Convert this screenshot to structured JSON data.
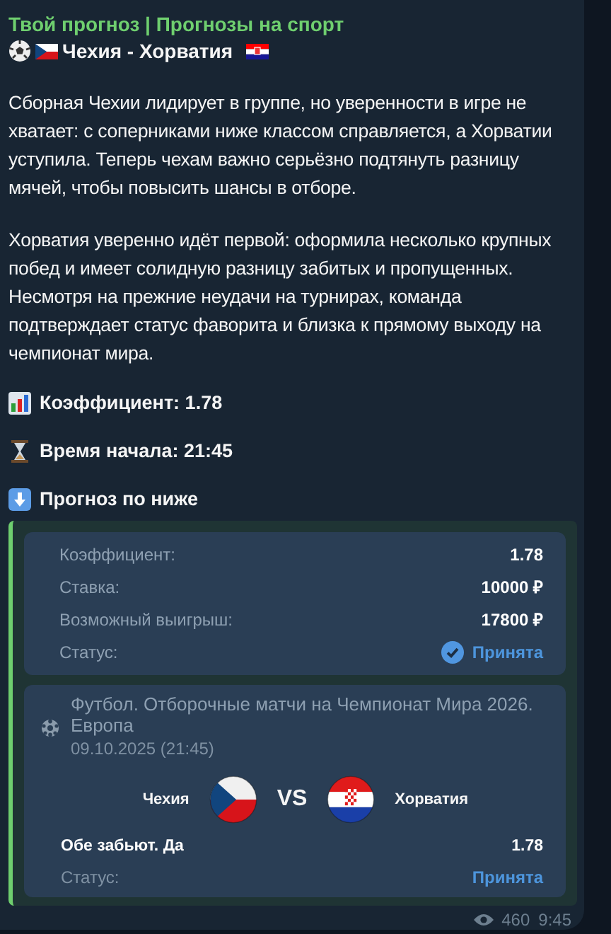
{
  "channel_title": "Твой прогноз | Прогнозы на спорт",
  "headline": {
    "text": "Чехия - Хорватия"
  },
  "paragraphs": [
    "Сборная Чехии лидирует в группе, но уверенности в игре не хватает: с соперниками ниже классом справляется, а Хорватии уступила. Теперь чехам важно серьёзно подтянуть разницу мячей, чтобы повысить шансы в отборе.",
    "Хорватия уверенно идёт первой: оформила несколько крупных побед и имеет солидную разницу забитых и пропущенных. Несмотря на прежние неудачи на турнирах, команда подтверждает статус фаворита и близка к прямому выходу на чемпионат мира."
  ],
  "info_lines": [
    {
      "kind": "chart",
      "text": "Коэффициент: 1.78"
    },
    {
      "kind": "hourglass",
      "text": "Время начала: 21:45"
    },
    {
      "kind": "arrow",
      "text": "Прогноз по ниже"
    }
  ],
  "slip_rows": [
    {
      "kind": "plain",
      "label": "Коэффициент:",
      "value": "1.78"
    },
    {
      "kind": "plain",
      "label": "Ставка:",
      "value": "10000 ₽"
    },
    {
      "kind": "plain",
      "label": "Возможный выигрыш:",
      "value": "17800 ₽"
    },
    {
      "kind": "status",
      "label": "Статус:",
      "value": "Принята"
    }
  ],
  "event": {
    "tournament": "Футбол. Отборочные матчи на Чемпионат Мира 2026. Европа",
    "date": "09.10.2025 (21:45)",
    "home": {
      "name": "Чехия"
    },
    "vs": "VS",
    "away": {
      "name": "Хорватия"
    },
    "pick": "Обе забьют. Да",
    "odds": "1.78",
    "status_label": "Статус:",
    "status_value": "Принята"
  },
  "footer": {
    "views": "460",
    "time": "9:45"
  }
}
